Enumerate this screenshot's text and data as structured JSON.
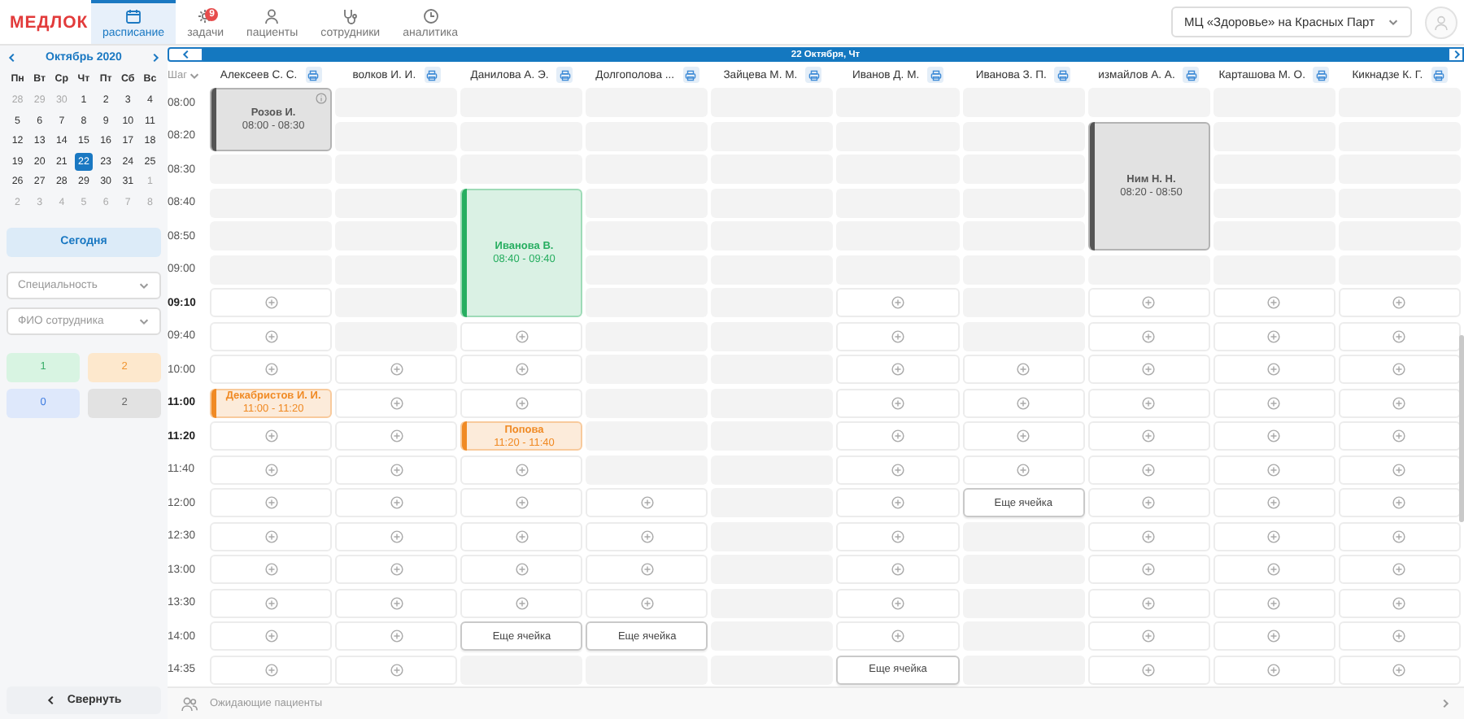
{
  "logo": "МЕДЛОК",
  "nav": [
    {
      "label": "расписание",
      "selected": true
    },
    {
      "label": "задачи",
      "selected": false,
      "badge": "9"
    },
    {
      "label": "пациенты",
      "selected": false
    },
    {
      "label": "сотрудники",
      "selected": false
    },
    {
      "label": "аналитика",
      "selected": false
    }
  ],
  "clinic_select": {
    "value": "МЦ «Здоровье» на Красных Парт"
  },
  "calendar": {
    "month": "Октябрь 2020",
    "weekdays": [
      "Пн",
      "Вт",
      "Ср",
      "Чт",
      "Пт",
      "Сб",
      "Вс"
    ],
    "days": [
      {
        "label": "28",
        "outside": true,
        "selected": false
      },
      {
        "label": "29",
        "outside": true,
        "selected": false
      },
      {
        "label": "30",
        "outside": true,
        "selected": false
      },
      {
        "label": "1",
        "outside": false,
        "selected": false
      },
      {
        "label": "2",
        "outside": false,
        "selected": false
      },
      {
        "label": "3",
        "outside": false,
        "selected": false
      },
      {
        "label": "4",
        "outside": false,
        "selected": false
      },
      {
        "label": "5",
        "outside": false,
        "selected": false
      },
      {
        "label": "6",
        "outside": false,
        "selected": false
      },
      {
        "label": "7",
        "outside": false,
        "selected": false
      },
      {
        "label": "8",
        "outside": false,
        "selected": false
      },
      {
        "label": "9",
        "outside": false,
        "selected": false
      },
      {
        "label": "10",
        "outside": false,
        "selected": false
      },
      {
        "label": "11",
        "outside": false,
        "selected": false
      },
      {
        "label": "12",
        "outside": false,
        "selected": false
      },
      {
        "label": "13",
        "outside": false,
        "selected": false
      },
      {
        "label": "14",
        "outside": false,
        "selected": false
      },
      {
        "label": "15",
        "outside": false,
        "selected": false
      },
      {
        "label": "16",
        "outside": false,
        "selected": false
      },
      {
        "label": "17",
        "outside": false,
        "selected": false
      },
      {
        "label": "18",
        "outside": false,
        "selected": false
      },
      {
        "label": "19",
        "outside": false,
        "selected": false
      },
      {
        "label": "20",
        "outside": false,
        "selected": false
      },
      {
        "label": "21",
        "outside": false,
        "selected": false
      },
      {
        "label": "22",
        "outside": false,
        "selected": true
      },
      {
        "label": "23",
        "outside": false,
        "selected": false
      },
      {
        "label": "24",
        "outside": false,
        "selected": false
      },
      {
        "label": "25",
        "outside": false,
        "selected": false
      },
      {
        "label": "26",
        "outside": false,
        "selected": false
      },
      {
        "label": "27",
        "outside": false,
        "selected": false
      },
      {
        "label": "28",
        "outside": false,
        "selected": false
      },
      {
        "label": "29",
        "outside": false,
        "selected": false
      },
      {
        "label": "30",
        "outside": false,
        "selected": false
      },
      {
        "label": "31",
        "outside": false,
        "selected": false
      },
      {
        "label": "1",
        "outside": true,
        "selected": false
      },
      {
        "label": "2",
        "outside": true,
        "selected": false
      },
      {
        "label": "3",
        "outside": true,
        "selected": false
      },
      {
        "label": "4",
        "outside": true,
        "selected": false
      },
      {
        "label": "5",
        "outside": true,
        "selected": false
      },
      {
        "label": "6",
        "outside": true,
        "selected": false
      },
      {
        "label": "7",
        "outside": true,
        "selected": false
      },
      {
        "label": "8",
        "outside": true,
        "selected": false
      }
    ]
  },
  "today_button": "Сегодня",
  "filters": [
    {
      "placeholder": "Специальность"
    },
    {
      "placeholder": "ФИО сотрудника"
    }
  ],
  "counters": [
    {
      "value": "1",
      "kind": "arrived"
    },
    {
      "value": "2",
      "kind": "waiting"
    },
    {
      "value": "0",
      "kind": "booked"
    },
    {
      "value": "2",
      "kind": "finished"
    }
  ],
  "collapse_button": "Свернуть",
  "schedule": {
    "date": "22 Октября, Чт",
    "step_label": "Шаг",
    "doctors": [
      "Алексеев С. С.",
      "волков И. И.",
      "Данилова А. Э.",
      "Долгополова ...",
      "Зайцева М. М.",
      "Иванов Д. М.",
      "Иванова З. П.",
      "измайлов А. А.",
      "Карташова М. О.",
      "Кикнадзе К. Г."
    ],
    "rows": [
      {
        "time": "08:00",
        "bold": false,
        "cells": [
          {
            "kind": "appointment",
            "patient": "Розов И.",
            "time": "08:00 - 08:30",
            "color": "#555555",
            "note": true
          },
          {
            "kind": "off"
          },
          {
            "kind": "off"
          },
          {
            "kind": "off"
          },
          {
            "kind": "off"
          },
          {
            "kind": "off"
          },
          {
            "kind": "off"
          },
          {
            "kind": "off"
          },
          {
            "kind": "off"
          },
          {
            "kind": "off"
          }
        ]
      },
      {
        "time": "08:20",
        "bold": false,
        "cells": [
          {
            "kind": "covered"
          },
          {
            "kind": "off"
          },
          {
            "kind": "off"
          },
          {
            "kind": "off"
          },
          {
            "kind": "off"
          },
          {
            "kind": "off"
          },
          {
            "kind": "off"
          },
          {
            "kind": "appointment",
            "patient": "Ним Н. Н.",
            "time": "08:20 - 08:50",
            "color": "#555555",
            "note": false
          },
          {
            "kind": "off"
          },
          {
            "kind": "off"
          }
        ]
      },
      {
        "time": "08:30",
        "bold": false,
        "cells": [
          {
            "kind": "off"
          },
          {
            "kind": "off"
          },
          {
            "kind": "off"
          },
          {
            "kind": "off"
          },
          {
            "kind": "off"
          },
          {
            "kind": "off"
          },
          {
            "kind": "off"
          },
          {
            "kind": "covered"
          },
          {
            "kind": "off"
          },
          {
            "kind": "off"
          }
        ]
      },
      {
        "time": "08:40",
        "bold": false,
        "cells": [
          {
            "kind": "off"
          },
          {
            "kind": "off"
          },
          {
            "kind": "appointment",
            "patient": "Иванова В.",
            "time": "08:40 - 09:40",
            "color": "#27ae60",
            "note": false
          },
          {
            "kind": "off"
          },
          {
            "kind": "off"
          },
          {
            "kind": "off"
          },
          {
            "kind": "off"
          },
          {
            "kind": "covered"
          },
          {
            "kind": "off"
          },
          {
            "kind": "off"
          }
        ]
      },
      {
        "time": "08:50",
        "bold": false,
        "cells": [
          {
            "kind": "off"
          },
          {
            "kind": "off"
          },
          {
            "kind": "covered"
          },
          {
            "kind": "off"
          },
          {
            "kind": "off"
          },
          {
            "kind": "off"
          },
          {
            "kind": "off"
          },
          {
            "kind": "covered"
          },
          {
            "kind": "off"
          },
          {
            "kind": "off"
          }
        ]
      },
      {
        "time": "09:00",
        "bold": false,
        "cells": [
          {
            "kind": "off"
          },
          {
            "kind": "off"
          },
          {
            "kind": "covered"
          },
          {
            "kind": "off"
          },
          {
            "kind": "off"
          },
          {
            "kind": "off"
          },
          {
            "kind": "off"
          },
          {
            "kind": "off"
          },
          {
            "kind": "off"
          },
          {
            "kind": "off"
          }
        ]
      },
      {
        "time": "09:10",
        "bold": true,
        "cells": [
          {
            "kind": "free"
          },
          {
            "kind": "off"
          },
          {
            "kind": "covered"
          },
          {
            "kind": "off"
          },
          {
            "kind": "off"
          },
          {
            "kind": "free"
          },
          {
            "kind": "off"
          },
          {
            "kind": "free"
          },
          {
            "kind": "free"
          },
          {
            "kind": "free"
          }
        ]
      },
      {
        "time": "09:40",
        "bold": false,
        "cells": [
          {
            "kind": "free"
          },
          {
            "kind": "off"
          },
          {
            "kind": "free"
          },
          {
            "kind": "off"
          },
          {
            "kind": "off"
          },
          {
            "kind": "free"
          },
          {
            "kind": "off"
          },
          {
            "kind": "free"
          },
          {
            "kind": "free"
          },
          {
            "kind": "free"
          }
        ]
      },
      {
        "time": "10:00",
        "bold": false,
        "cells": [
          {
            "kind": "free"
          },
          {
            "kind": "free"
          },
          {
            "kind": "free"
          },
          {
            "kind": "off"
          },
          {
            "kind": "off"
          },
          {
            "kind": "free"
          },
          {
            "kind": "free"
          },
          {
            "kind": "free"
          },
          {
            "kind": "free"
          },
          {
            "kind": "free"
          }
        ]
      },
      {
        "time": "11:00",
        "bold": true,
        "cells": [
          {
            "kind": "appointment",
            "patient": "Декабристов И. И.",
            "time": "11:00 - 11:20",
            "color": "#f08a24",
            "note": false
          },
          {
            "kind": "free"
          },
          {
            "kind": "free"
          },
          {
            "kind": "off"
          },
          {
            "kind": "off"
          },
          {
            "kind": "free"
          },
          {
            "kind": "free"
          },
          {
            "kind": "free"
          },
          {
            "kind": "free"
          },
          {
            "kind": "free"
          }
        ]
      },
      {
        "time": "11:20",
        "bold": true,
        "cells": [
          {
            "kind": "free"
          },
          {
            "kind": "free"
          },
          {
            "kind": "appointment",
            "patient": "Попова",
            "time": "11:20 - 11:40",
            "color": "#f08a24",
            "note": false
          },
          {
            "kind": "off"
          },
          {
            "kind": "off"
          },
          {
            "kind": "free"
          },
          {
            "kind": "free"
          },
          {
            "kind": "free"
          },
          {
            "kind": "free"
          },
          {
            "kind": "free"
          }
        ]
      },
      {
        "time": "11:40",
        "bold": false,
        "cells": [
          {
            "kind": "free"
          },
          {
            "kind": "free"
          },
          {
            "kind": "free"
          },
          {
            "kind": "off"
          },
          {
            "kind": "off"
          },
          {
            "kind": "free"
          },
          {
            "kind": "free"
          },
          {
            "kind": "free"
          },
          {
            "kind": "free"
          },
          {
            "kind": "free"
          }
        ]
      },
      {
        "time": "12:00",
        "bold": false,
        "cells": [
          {
            "kind": "free"
          },
          {
            "kind": "free"
          },
          {
            "kind": "free"
          },
          {
            "kind": "free"
          },
          {
            "kind": "off"
          },
          {
            "kind": "free"
          },
          {
            "kind": "more",
            "label": "Еще ячейка"
          },
          {
            "kind": "free"
          },
          {
            "kind": "free"
          },
          {
            "kind": "free"
          }
        ]
      },
      {
        "time": "12:30",
        "bold": false,
        "cells": [
          {
            "kind": "free"
          },
          {
            "kind": "free"
          },
          {
            "kind": "free"
          },
          {
            "kind": "free"
          },
          {
            "kind": "off"
          },
          {
            "kind": "free"
          },
          {
            "kind": "off"
          },
          {
            "kind": "free"
          },
          {
            "kind": "free"
          },
          {
            "kind": "free"
          }
        ]
      },
      {
        "time": "13:00",
        "bold": false,
        "cells": [
          {
            "kind": "free"
          },
          {
            "kind": "free"
          },
          {
            "kind": "free"
          },
          {
            "kind": "free"
          },
          {
            "kind": "off"
          },
          {
            "kind": "free"
          },
          {
            "kind": "off"
          },
          {
            "kind": "free"
          },
          {
            "kind": "free"
          },
          {
            "kind": "free"
          }
        ]
      },
      {
        "time": "13:30",
        "bold": false,
        "cells": [
          {
            "kind": "free"
          },
          {
            "kind": "free"
          },
          {
            "kind": "free"
          },
          {
            "kind": "free"
          },
          {
            "kind": "off"
          },
          {
            "kind": "free"
          },
          {
            "kind": "off"
          },
          {
            "kind": "free"
          },
          {
            "kind": "free"
          },
          {
            "kind": "free"
          }
        ]
      },
      {
        "time": "14:00",
        "bold": false,
        "cells": [
          {
            "kind": "free"
          },
          {
            "kind": "free"
          },
          {
            "kind": "more",
            "label": "Еще ячейка"
          },
          {
            "kind": "more",
            "label": "Еще ячейка"
          },
          {
            "kind": "off"
          },
          {
            "kind": "free"
          },
          {
            "kind": "off"
          },
          {
            "kind": "free"
          },
          {
            "kind": "free"
          },
          {
            "kind": "free"
          }
        ]
      },
      {
        "time": "14:35",
        "bold": false,
        "cells": [
          {
            "kind": "free"
          },
          {
            "kind": "free"
          },
          {
            "kind": "off"
          },
          {
            "kind": "off"
          },
          {
            "kind": "off"
          },
          {
            "kind": "more",
            "label": "Еще ячейка"
          },
          {
            "kind": "off"
          },
          {
            "kind": "free"
          },
          {
            "kind": "free"
          },
          {
            "kind": "free"
          }
        ]
      }
    ]
  },
  "waiting_panel": "Ожидающие пациенты"
}
